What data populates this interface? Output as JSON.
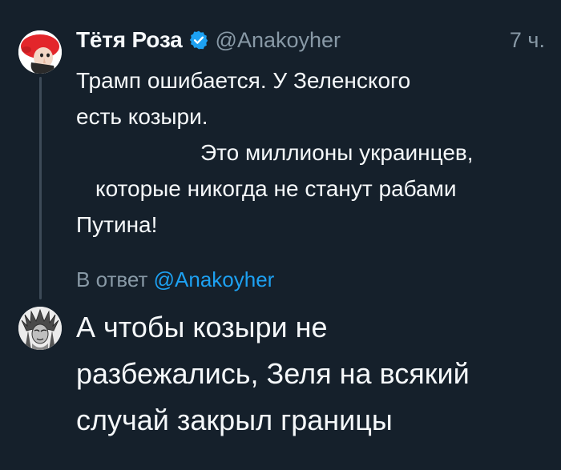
{
  "tweet": {
    "author": {
      "display_name": "Тётя Роза",
      "handle": "@Anakoyher",
      "verified_icon": "verified-badge-icon",
      "avatar_icon": "woman-red-hat-avatar"
    },
    "time": "7 ч.",
    "text_lines": [
      "Трамп ошибается. У Зеленского",
      "есть козыри.",
      "Это миллионы украинцев,",
      "которые никогда не станут рабами",
      "Путина!"
    ]
  },
  "reply": {
    "reply_to_label": "В ответ",
    "reply_to_handle": "@Anakoyher",
    "avatar_icon": "native-headdress-avatar",
    "text_lines": [
      "А чтобы козыри не",
      "разбежались, Зеля на всякий",
      "случай закрыл границы"
    ]
  },
  "colors": {
    "background": "#15202b",
    "text": "#f5f8fa",
    "secondary": "#8899a6",
    "accent": "#1da1f2"
  }
}
